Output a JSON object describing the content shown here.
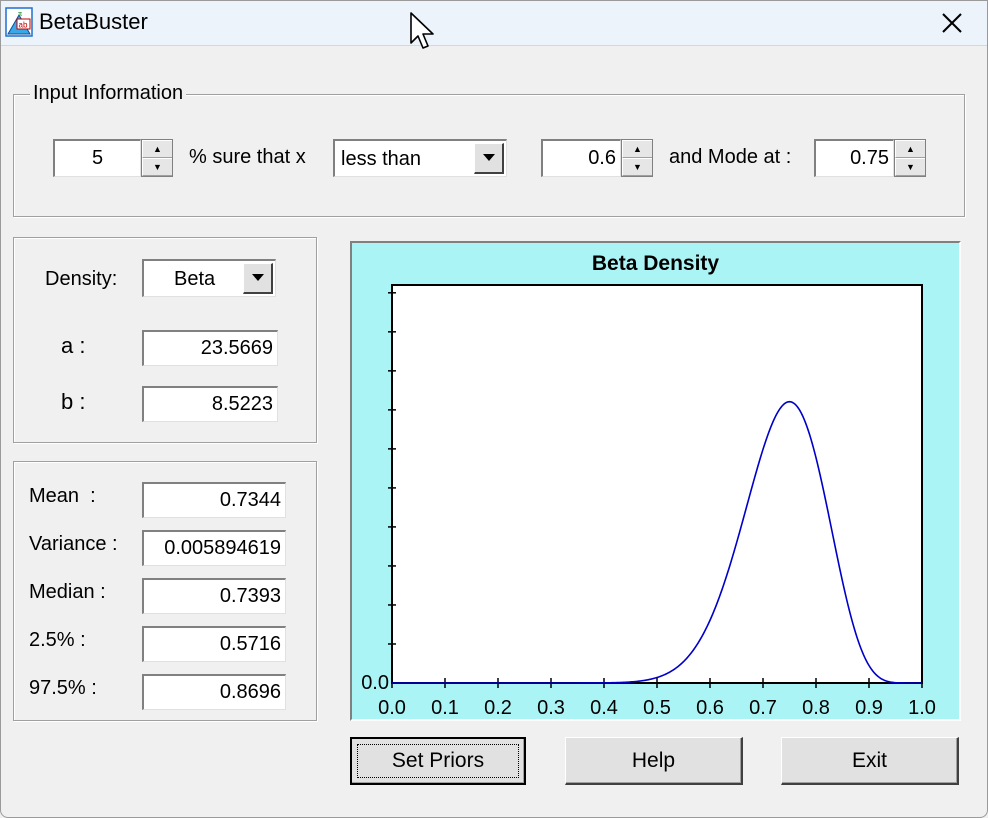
{
  "window": {
    "title": "BetaBuster"
  },
  "input_info": {
    "legend": "Input Information",
    "percent_value": "5",
    "sure_label": "% sure that x",
    "comparison": "less than",
    "x_value": "0.6",
    "mode_label": "and Mode at :",
    "mode_value": "0.75"
  },
  "parameters": {
    "density_label": "Density:",
    "density_value": "Beta",
    "a_label": "a :",
    "a_value": "23.5669",
    "b_label": "b :",
    "b_value": "8.5223"
  },
  "stats": {
    "rows": [
      {
        "label": "Mean  :",
        "value": "0.7344"
      },
      {
        "label": "Variance :",
        "value": "0.005894619"
      },
      {
        "label": "Median :",
        "value": "0.7393"
      },
      {
        "label": "2.5% :",
        "value": "0.5716"
      },
      {
        "label": "97.5% :",
        "value": "0.8696"
      }
    ]
  },
  "chart_data": {
    "type": "line",
    "title": "Beta Density",
    "xlabel": "",
    "ylabel": "",
    "xlim": [
      0.0,
      1.0
    ],
    "y_tick_label": "0.0",
    "x_ticks": [
      "0.0",
      "0.1",
      "0.2",
      "0.3",
      "0.4",
      "0.5",
      "0.6",
      "0.7",
      "0.8",
      "0.9",
      "1.0"
    ],
    "distribution": {
      "a": 23.5669,
      "b": 8.5223
    },
    "series": [
      {
        "color": "#0000c8",
        "x": [
          0.0,
          0.1,
          0.2,
          0.3,
          0.4,
          0.45,
          0.5,
          0.55,
          0.6,
          0.65,
          0.7,
          0.72,
          0.75,
          0.78,
          0.8,
          0.85,
          0.88,
          0.9,
          0.92,
          0.94,
          0.95,
          1.0
        ],
        "y": [
          0.0,
          0.0,
          0.0,
          0.0,
          0.01,
          0.06,
          0.24,
          0.76,
          1.89,
          3.71,
          5.7,
          6.29,
          6.62,
          6.22,
          5.6,
          3.23,
          1.79,
          1.0,
          0.42,
          0.11,
          0.04,
          0.0
        ]
      }
    ],
    "background": "#aaf4f6",
    "plot_background": "#ffffff",
    "grid": false
  },
  "buttons": {
    "set_priors": "Set Priors",
    "help": "Help",
    "exit": "Exit"
  }
}
